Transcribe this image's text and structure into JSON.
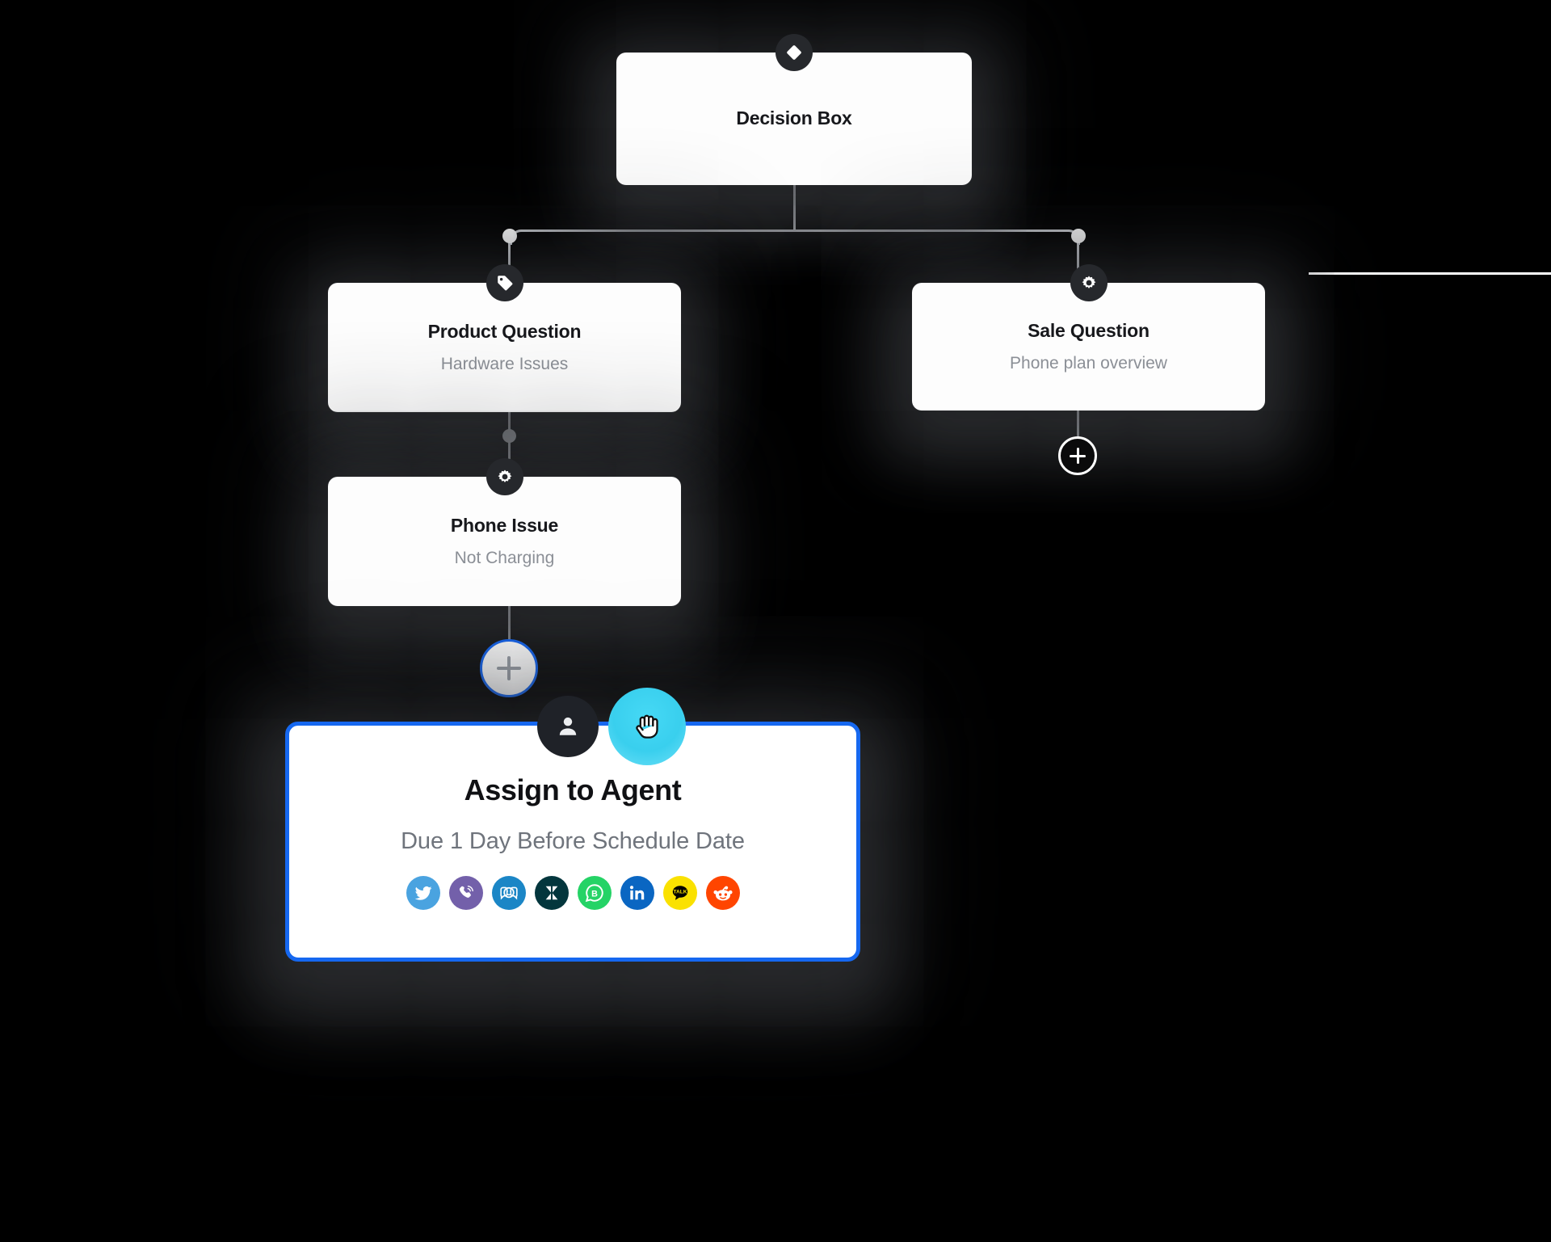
{
  "canvas": {
    "background_color": "#000000",
    "connector_color": "#c9ccd1",
    "accent_blue": "#1668f0",
    "badge_color": "#26282c",
    "rail_color": "#ffffff"
  },
  "nodes": {
    "decision": {
      "title": "Decision Box",
      "subtitle": "",
      "icon": "diamond-icon"
    },
    "product_question": {
      "title": "Product Question",
      "subtitle": "Hardware Issues",
      "icon": "tag-icon"
    },
    "sale_question": {
      "title": "Sale Question",
      "subtitle": "Phone plan overview",
      "icon": "gear-icon"
    },
    "phone_issue": {
      "title": "Phone Issue",
      "subtitle": "Not Charging",
      "icon": "gear-icon"
    },
    "assign_agent": {
      "title": "Assign to Agent",
      "subtitle": "Due 1 Day Before Schedule Date",
      "selected": "true",
      "border_color": "#1668f0"
    }
  },
  "buttons": {
    "add_node_left": {
      "label": "+",
      "name": "add-node-button-left",
      "style": "light"
    },
    "add_node_right": {
      "label": "+",
      "name": "add-node-button-right",
      "style": "dark"
    }
  },
  "cursors": {
    "avatar": {
      "icon": "person-icon",
      "color": "#1f2228"
    },
    "grab": {
      "icon": "hand-grab-cursor-icon",
      "color": "#3dd4f0"
    }
  },
  "channel_icons": [
    {
      "name": "twitter-icon",
      "label": "Twitter",
      "color": "#4aa3e0"
    },
    {
      "name": "viber-icon",
      "label": "Viber",
      "color": "#7360aa"
    },
    {
      "name": "jivochat-icon",
      "label": "JivoChat",
      "color": "#1b86c6"
    },
    {
      "name": "zendesk-icon",
      "label": "Zendesk",
      "color": "#03363d"
    },
    {
      "name": "whatsapp-business-icon",
      "label": "WhatsApp Business",
      "color": "#25d366"
    },
    {
      "name": "linkedin-icon",
      "label": "LinkedIn",
      "color": "#0a66c2"
    },
    {
      "name": "kakaotalk-icon",
      "label": "KakaoTalk",
      "color": "#fae100",
      "text": "TALK"
    },
    {
      "name": "reddit-icon",
      "label": "Reddit",
      "color": "#ff4500"
    }
  ]
}
